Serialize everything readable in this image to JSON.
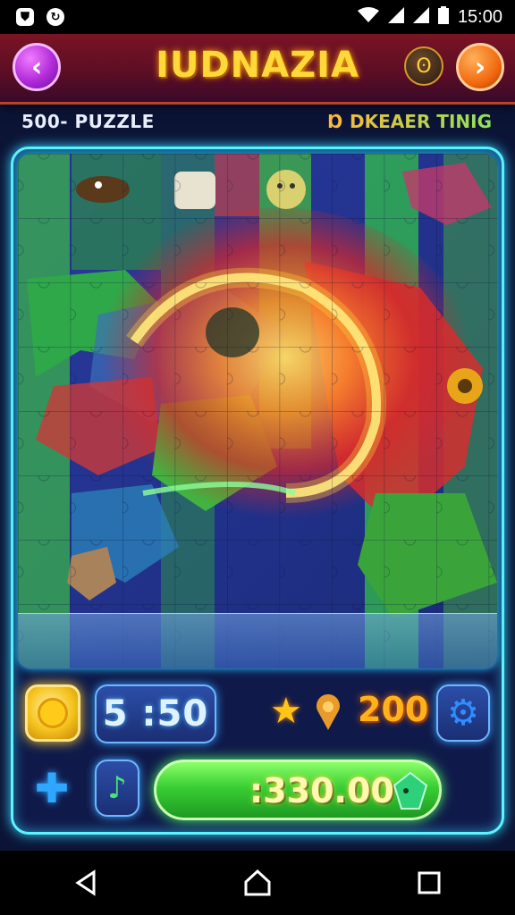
{
  "status_bar": {
    "left_icons": [
      "shield-icon",
      "sync-icon"
    ],
    "right_icons": [
      "wifi-icon",
      "signal-icon",
      "signal-icon",
      "battery-icon"
    ],
    "time": "15:00"
  },
  "header": {
    "title": "IUDNAZIA",
    "back_icon": "chevron-left-icon",
    "bomb_icon": "bomb-icon",
    "next_icon": "chevron-right-icon"
  },
  "subbar": {
    "left_label": "500- PUZZLE",
    "right_label": "Ɒ DKEAER TINIG"
  },
  "controls": {
    "coin_icon": "coin-icon",
    "timer": "5 :50",
    "star_icon": "star-icon",
    "pin_icon": "location-pin-icon",
    "score": "200",
    "settings_icon": "gear-icon",
    "hint_icon": "puzzle-hint-icon",
    "music_icon": "music-note-icon",
    "play_amount": ":330.00",
    "gem_icon": "gem-icon"
  },
  "nav": {
    "back_icon": "triangle-back-icon",
    "home_icon": "home-icon",
    "recents_icon": "square-recents-icon"
  },
  "colors": {
    "frame_glow": "#5ef3ff",
    "title": "#ffd83a",
    "score": "#ffb21a",
    "play_button": "#39cf33"
  }
}
